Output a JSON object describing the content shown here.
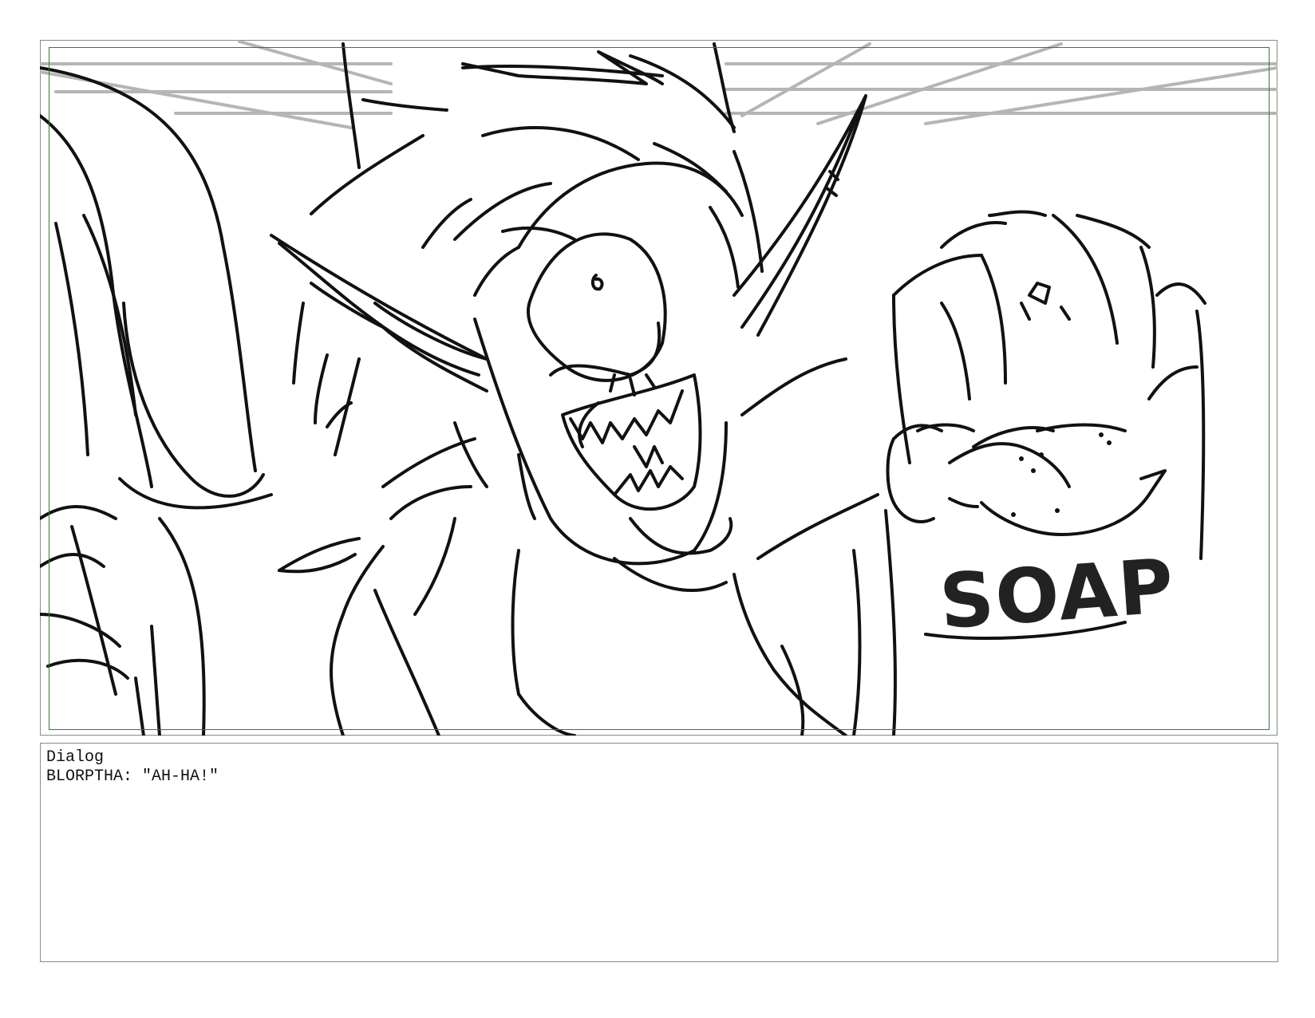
{
  "storyboard": {
    "panel": {
      "sign_text": "SOAP",
      "safe_area_color": "#2e7d32",
      "line_color": "#111111",
      "guide_color": "#b5b5b5"
    },
    "dialog": {
      "label": "Dialog",
      "line": "BLORPTHA: \"AH-HA!\""
    }
  }
}
